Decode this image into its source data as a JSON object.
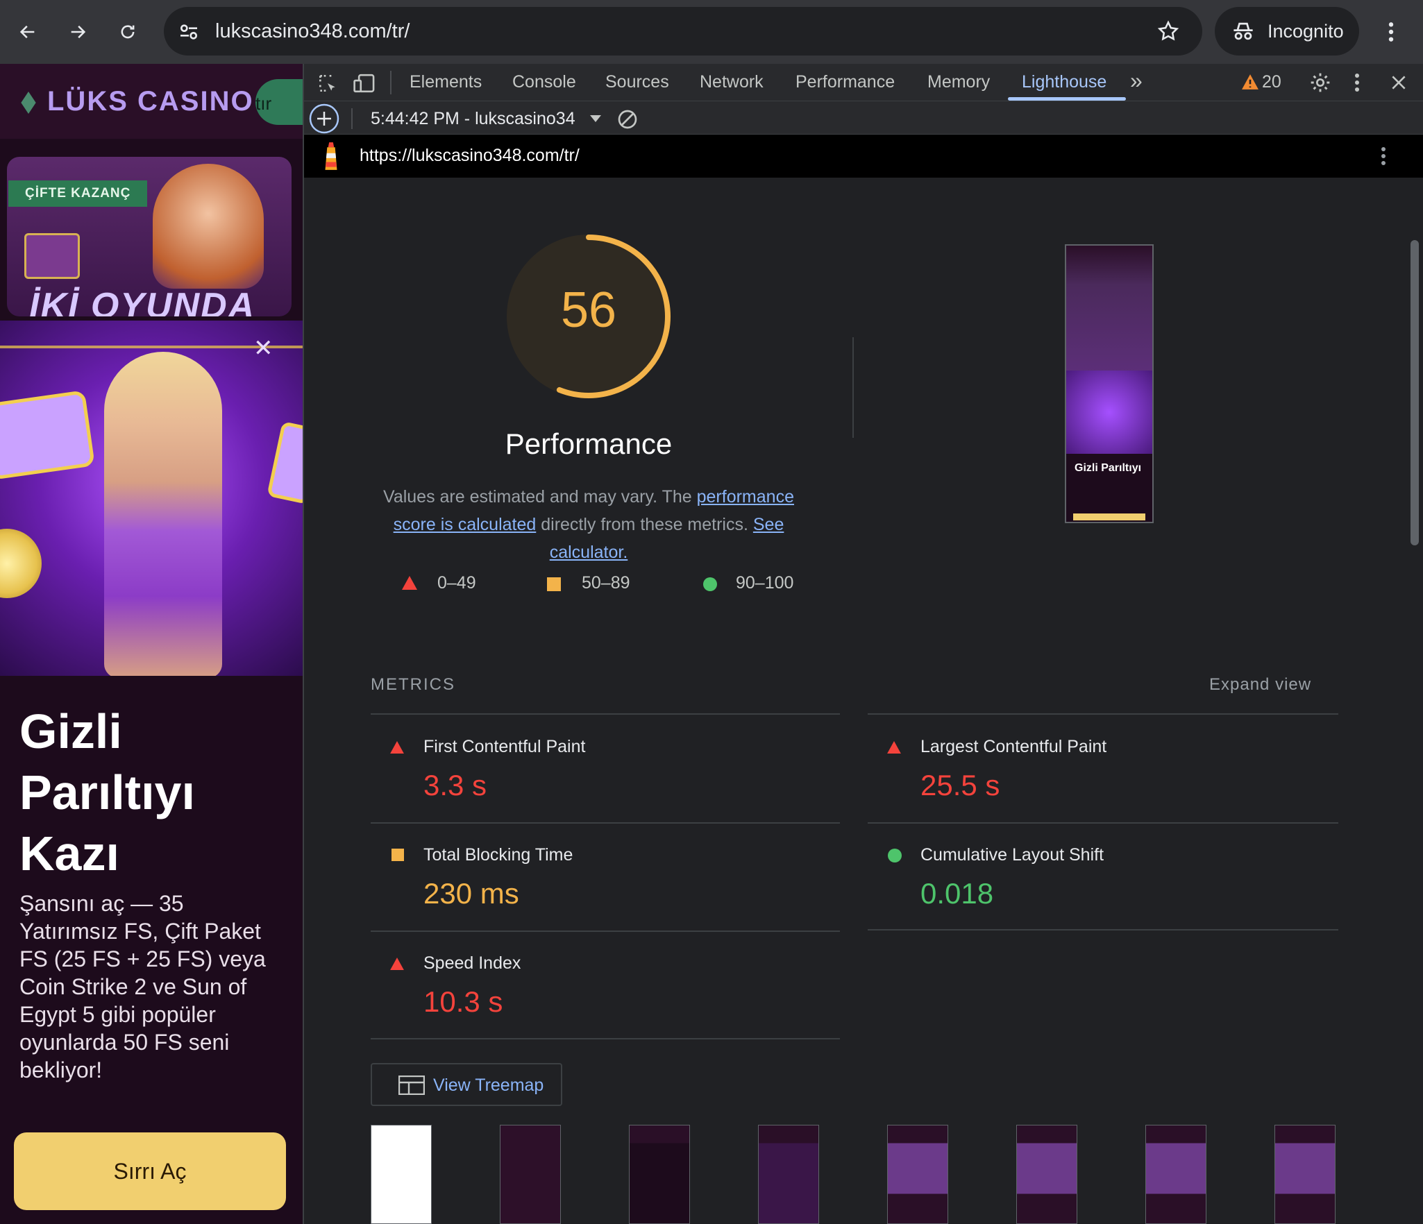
{
  "browser": {
    "url": "lukscasino348.com/tr/",
    "incognito_label": "Incognito"
  },
  "page": {
    "logo": "LÜKS CASINO",
    "login_partial": "tır",
    "badge": "ÇİFTE KAZANÇ",
    "banner_text": "İKİ OYUNDA",
    "promo_title_lines": [
      "Gizli",
      "Parıltıyı",
      "Kazı"
    ],
    "promo_description": "Şansını aç — 35 Yatırımsız FS, Çift Paket FS (25 FS + 25 FS) veya Coin Strike 2 ve Sun of Egypt 5 gibi popüler oyunlarda 50 FS seni bekliyor!",
    "cta": "Sırrı Aç"
  },
  "devtools": {
    "tabs": [
      "Elements",
      "Console",
      "Sources",
      "Network",
      "Performance",
      "Memory",
      "Lighthouse"
    ],
    "active_tab": "Lighthouse",
    "warning_count": "20",
    "report_selector": "5:44:42 PM - lukscasino34",
    "report_url": "https://lukscasino348.com/tr/"
  },
  "report": {
    "score": "56",
    "score_fraction": 0.56,
    "category": "Performance",
    "note_prefix": "Values are estimated and may vary. The ",
    "note_link1": "performance score is calculated",
    "note_mid": " directly from these metrics. ",
    "note_link2": "See calculator.",
    "legend": [
      "0–49",
      "50–89",
      "90–100"
    ],
    "metrics_header": "METRICS",
    "expand_label": "Expand view",
    "treemap_label": "View Treemap",
    "screenshot_caption": "Gizli Parıltıyı",
    "metrics": [
      {
        "name": "First Contentful Paint",
        "value": "3.3 s",
        "rating": "fail"
      },
      {
        "name": "Largest Contentful Paint",
        "value": "25.5 s",
        "rating": "fail"
      },
      {
        "name": "Total Blocking Time",
        "value": "230 ms",
        "rating": "average"
      },
      {
        "name": "Cumulative Layout Shift",
        "value": "0.018",
        "rating": "pass"
      },
      {
        "name": "Speed Index",
        "value": "10.3 s",
        "rating": "fail"
      }
    ]
  },
  "colors": {
    "fail": "#f4433c",
    "average": "#f3b34a",
    "pass": "#4ec46b",
    "link": "#8ab4f8"
  }
}
